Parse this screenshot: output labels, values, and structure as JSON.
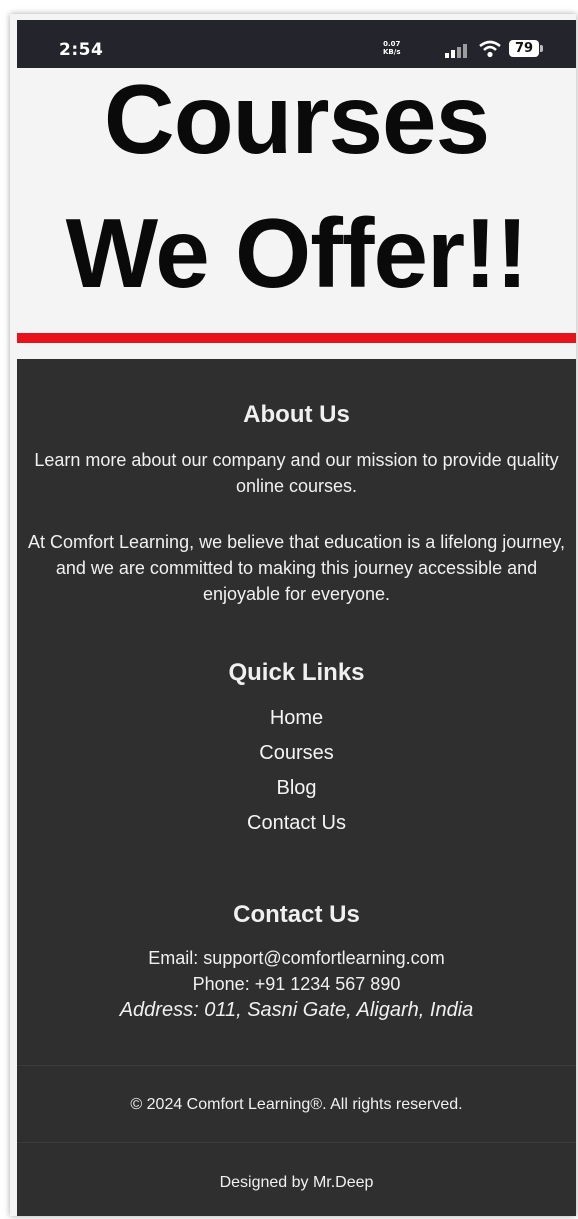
{
  "status_bar": {
    "time": "2:54",
    "net_speed_value": "0.07",
    "net_speed_unit": "KB/s",
    "battery": "79"
  },
  "hero": {
    "title_line1": "Courses",
    "title_line2": "We Offer!!"
  },
  "about": {
    "title": "About Us",
    "paragraph1": "Learn more about our company and our mission to provide quality online courses.",
    "paragraph2": "At Comfort Learning, we believe that education is a lifelong journey, and we are committed to making this journey accessible and enjoyable for everyone."
  },
  "quick_links": {
    "title": "Quick Links",
    "items": [
      "Home",
      "Courses",
      "Blog",
      "Contact Us"
    ]
  },
  "contact": {
    "title": "Contact Us",
    "email": "Email: support@comfortlearning.com",
    "phone": "Phone: +91 1234 567 890",
    "address": "Address: 011, Sasni Gate, Aligarh, India"
  },
  "footer": {
    "copyright": "© 2024 Comfort Learning®. All rights reserved.",
    "designed_by": "Designed by Mr.Deep"
  },
  "colors": {
    "accent_red": "#e8121a",
    "footer_bg": "#2f2f2f",
    "status_bg": "#24242c"
  }
}
